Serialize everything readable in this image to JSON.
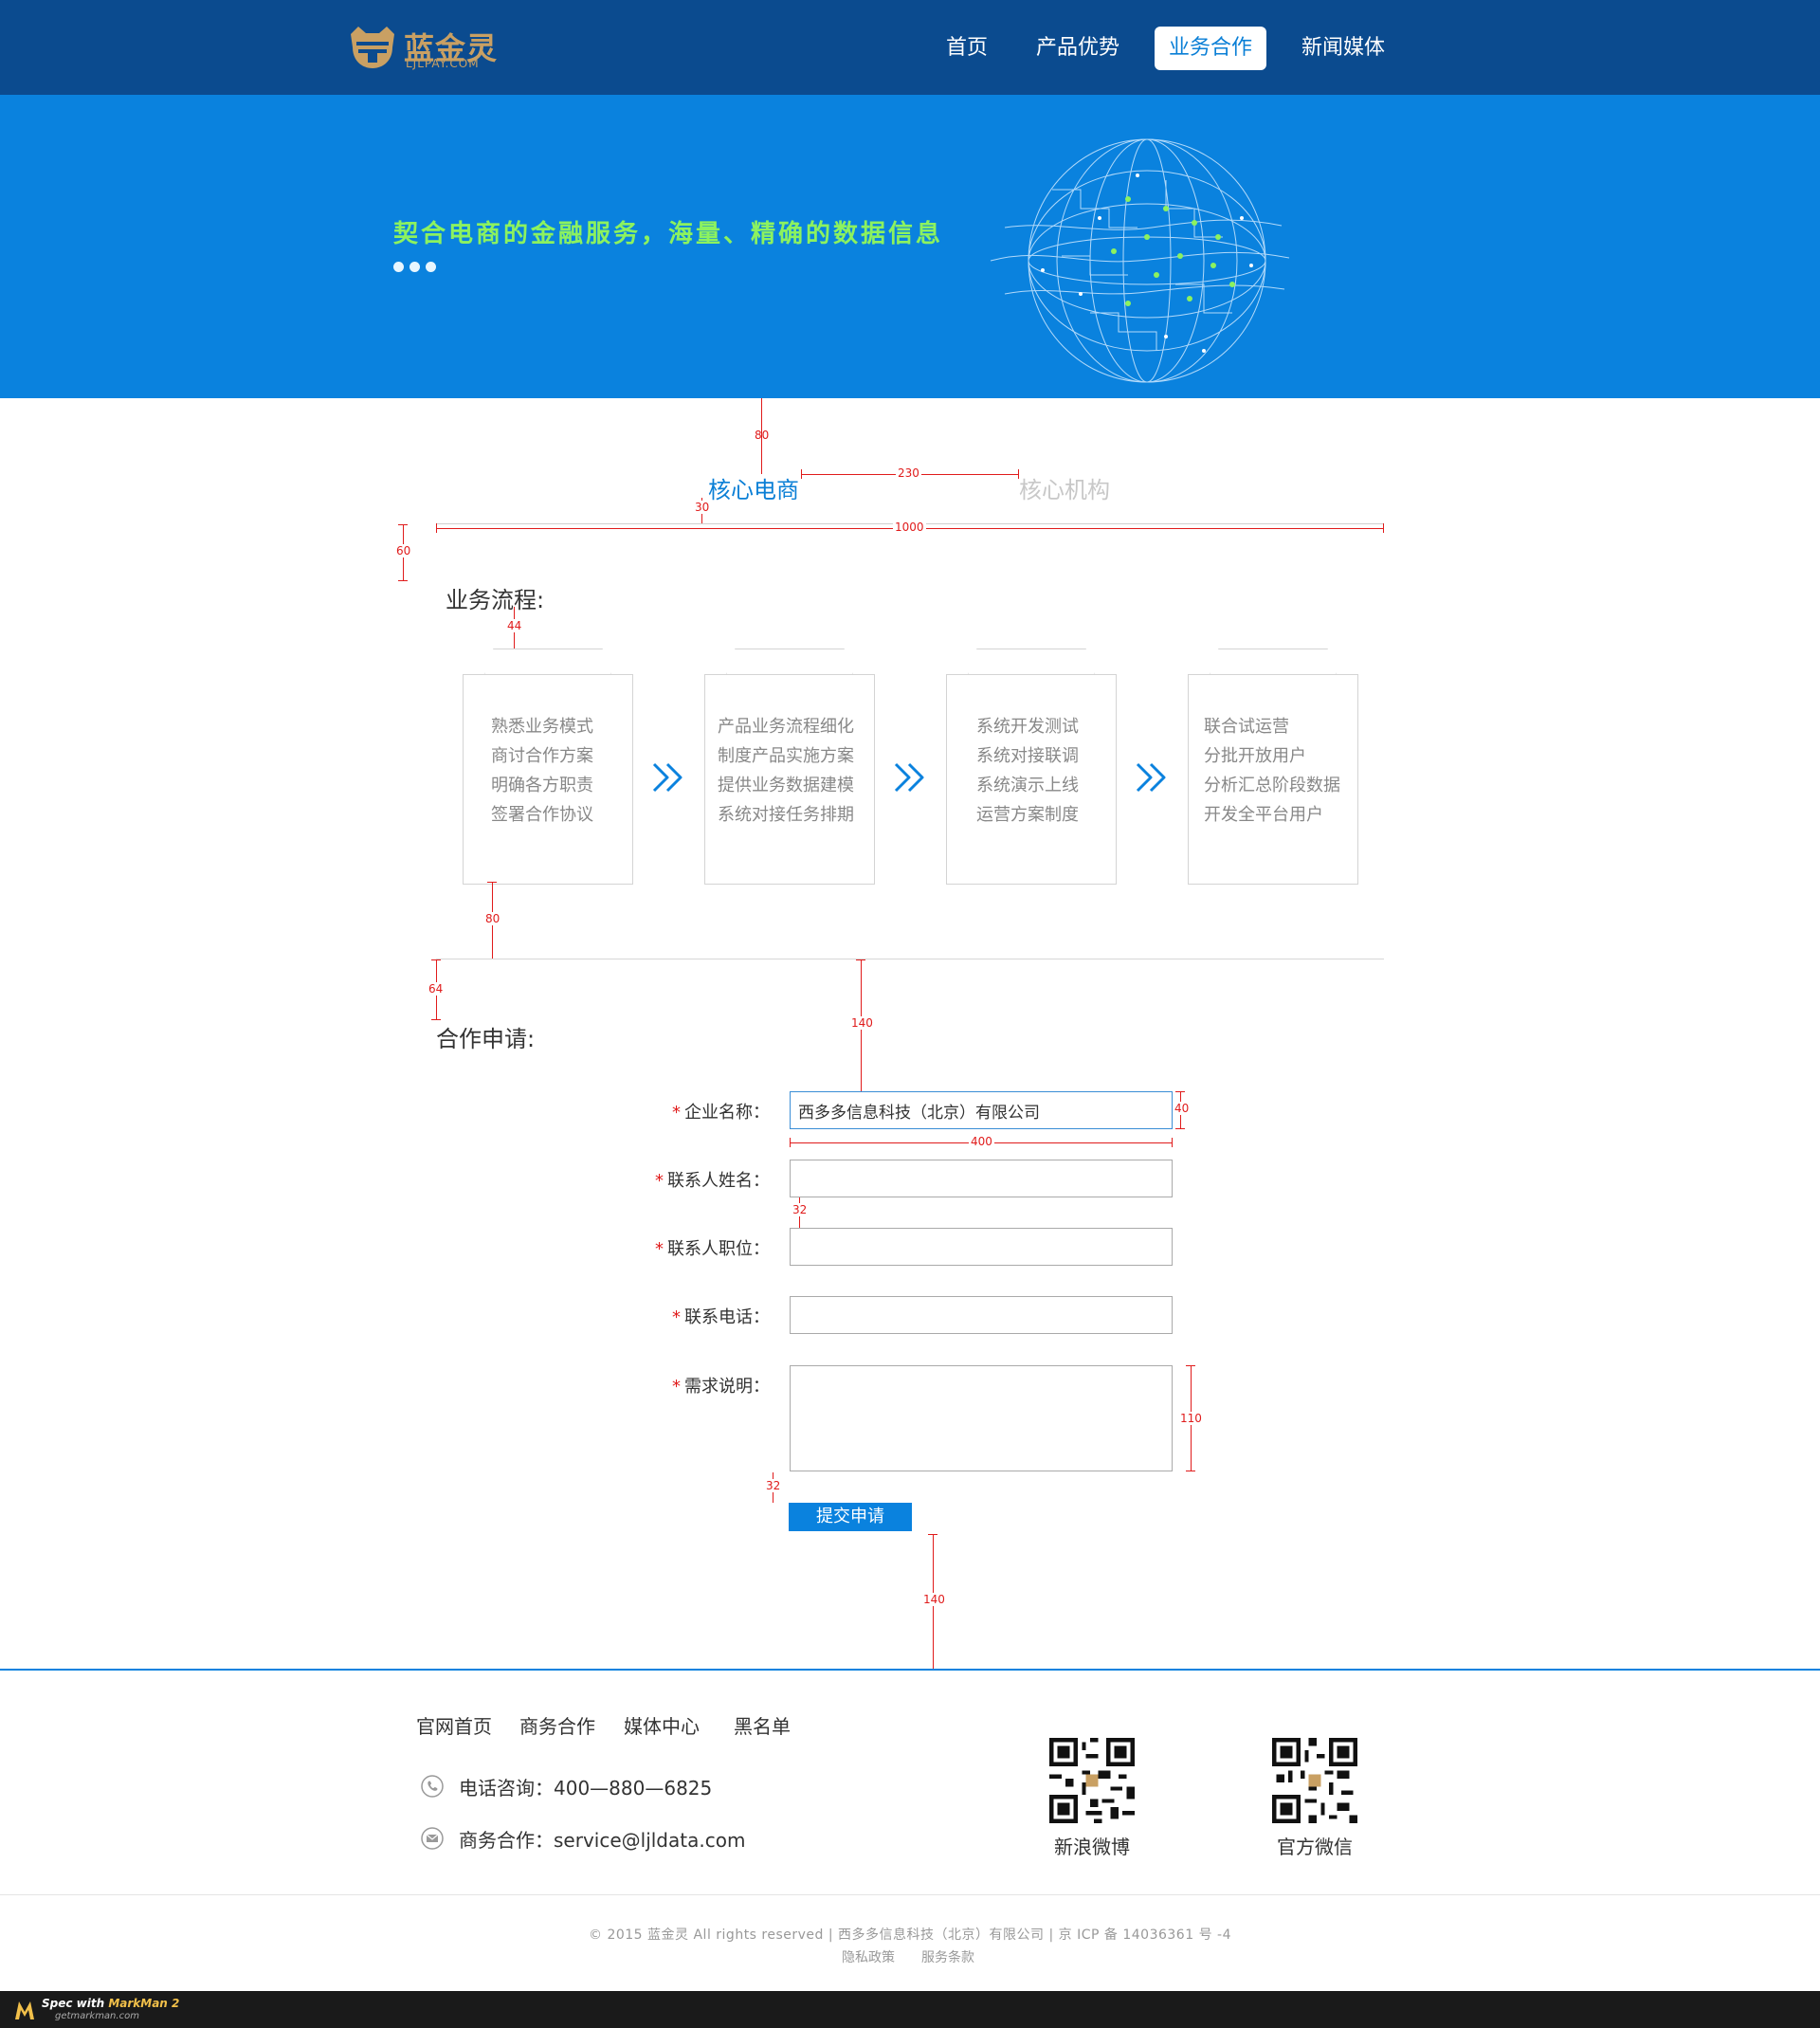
{
  "brand": {
    "name": "蓝金灵",
    "domain": "LJLPAY.COM",
    "accent": "#0a82de",
    "header_bg": "#0b4b8f",
    "gold": "#c9a063",
    "slogan_color": "#8cf25f"
  },
  "nav": {
    "items": [
      {
        "label": "首页",
        "active": false
      },
      {
        "label": "产品优势",
        "active": false
      },
      {
        "label": "业务合作",
        "active": true
      },
      {
        "label": "新闻媒体",
        "active": false
      }
    ]
  },
  "banner": {
    "slogan": "契合电商的金融服务，海量、精确的数据信息",
    "icon": "globe-network-graphic"
  },
  "tabs": [
    {
      "label": "核心电商",
      "active": true
    },
    {
      "label": "核心机构",
      "active": false
    }
  ],
  "process": {
    "title": "业务流程:",
    "steps": [
      {
        "lines": [
          "熟悉业务模式",
          "商讨合作方案",
          "明确各方职责",
          "签署合作协议"
        ]
      },
      {
        "lines": [
          "产品业务流程细化",
          "制度产品实施方案",
          "提供业务数据建模",
          "系统对接任务排期"
        ]
      },
      {
        "lines": [
          "系统开发测试",
          "系统对接联调",
          "系统演示上线",
          "运营方案制度"
        ]
      },
      {
        "lines": [
          "联合试运营",
          "分批开放用户",
          "分析汇总阶段数据",
          "开发全平台用户"
        ]
      }
    ],
    "arrow_icon": "double-chevron-right-icon"
  },
  "form": {
    "title": "合作申请:",
    "required_mark": "*",
    "fields": {
      "company": {
        "label": "企业名称：",
        "value": "西多多信息科技（北京）有限公司"
      },
      "contact_name": {
        "label": "联系人姓名：",
        "value": ""
      },
      "contact_position": {
        "label": "联系人职位：",
        "value": ""
      },
      "phone": {
        "label": "联系电话：",
        "value": ""
      },
      "requirements": {
        "label": "需求说明：",
        "value": ""
      }
    },
    "submit_label": "提交申请"
  },
  "measurements": {
    "m80a": "80",
    "m230": "230",
    "m30": "30",
    "m1000": "1000",
    "m60": "60",
    "m44": "44",
    "m80b": "80",
    "m64": "64",
    "m140a": "140",
    "m40": "40",
    "m400": "400",
    "m32a": "32",
    "m110": "110",
    "m32b": "32",
    "m140b": "140"
  },
  "footer": {
    "links": [
      "官网首页",
      "商务合作",
      "媒体中心",
      "黑名单"
    ],
    "phone": {
      "icon": "phone-icon",
      "label": "电话咨询：",
      "value": "400—880—6825"
    },
    "email": {
      "icon": "mail-icon",
      "label": "商务合作：",
      "value": "service@ljldata.com"
    },
    "qr": [
      {
        "label": "新浪微博",
        "icon": "qr-code-icon"
      },
      {
        "label": "官方微信",
        "icon": "qr-code-icon"
      }
    ],
    "copyright": "© 2015 蓝金灵 All rights reserved | 西多多信息科技（北京）有限公司 | 京 ICP 备 14036361 号 -4",
    "policy_links": [
      "隐私政策",
      "服务条款"
    ]
  },
  "markman": {
    "text_prefix": "Spec with ",
    "text_brand": "MarkMan 2",
    "url": "getmarkman.com"
  }
}
